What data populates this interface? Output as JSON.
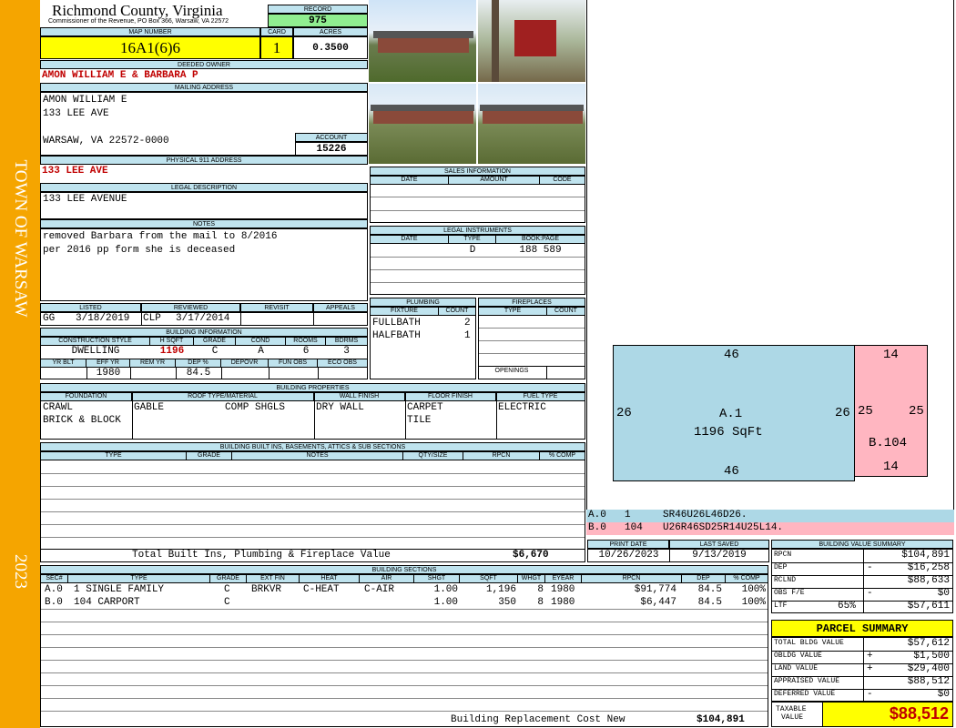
{
  "sidebar": {
    "town": "TOWN OF WARSAW",
    "year": "2023"
  },
  "header": {
    "county": "Richmond County, Virginia",
    "commissioner": "Commissioner of the Revenue, PO Box 366, Warsaw, VA 22572"
  },
  "record": {
    "label": "RECORD",
    "value": "975"
  },
  "map": {
    "label": "MAP NUMBER",
    "value": "16A1(6)6"
  },
  "card": {
    "label": "CARD",
    "value": "1"
  },
  "acres": {
    "label": "ACRES",
    "value": "0.3500"
  },
  "owner": {
    "label": "DEEDED OWNER",
    "value": "AMON WILLIAM E & BARBARA P"
  },
  "mailing": {
    "label": "MAILING ADDRESS",
    "line1": "AMON WILLIAM E",
    "line2": "133 LEE AVE",
    "line3": "WARSAW, VA 22572-0000"
  },
  "account": {
    "label": "ACCOUNT",
    "value": "15226"
  },
  "physical": {
    "label": "PHYSICAL 911 ADDRESS",
    "value": "133 LEE AVE"
  },
  "legal": {
    "label": "LEGAL DESCRIPTION",
    "value": "133 LEE AVENUE"
  },
  "notes": {
    "label": "NOTES",
    "line1": "removed Barbara from the mail to 8/2016",
    "line2": "per 2016 pp form she is deceased"
  },
  "status": {
    "listed_label": "LISTED",
    "reviewed_label": "REVIEWED",
    "revisit_label": "REVISIT",
    "appeals_label": "APPEALS",
    "listed_by": "GG",
    "listed_date": "3/18/2019",
    "reviewed_by": "CLP",
    "reviewed_date": "3/17/2014"
  },
  "building_info": {
    "label": "BUILDING INFORMATION",
    "headers1": [
      "CONSTRUCTION STYLE",
      "H SQFT",
      "GRADE",
      "COND",
      "ROOMS",
      "BDRMS"
    ],
    "style": "DWELLING",
    "hsqft": "1196",
    "grade": "C",
    "cond": "A",
    "rooms": "6",
    "bdrms": "3",
    "headers2": [
      "YR BLT",
      "EFF YR",
      "REM YR",
      "DEP %",
      "DEPOVR",
      "FUN OBS",
      "ECO OBS"
    ],
    "eff_yr": "1980",
    "dep": "84.5"
  },
  "sales": {
    "label": "SALES INFORMATION",
    "headers": [
      "DATE",
      "AMOUNT",
      "CODE"
    ]
  },
  "legal_instruments": {
    "label": "LEGAL INSTRUMENTS",
    "headers": [
      "DATE",
      "TYPE",
      "BOOK:PAGE"
    ],
    "type": "D",
    "bookpage": "188 589"
  },
  "plumbing": {
    "label": "PLUMBING",
    "headers": [
      "FIXTURE",
      "COUNT"
    ],
    "rows": [
      {
        "fixture": "FULLBATH",
        "count": "2"
      },
      {
        "fixture": "HALFBATH",
        "count": "1"
      }
    ]
  },
  "fireplaces": {
    "label": "FIREPLACES",
    "headers": [
      "TYPE",
      "COUNT"
    ],
    "openings": "OPENINGS"
  },
  "properties": {
    "label": "BUILDING PROPERTIES",
    "headers": [
      "FOUNDATION",
      "ROOF TYPE/MATERIAL",
      "WALL FINISH",
      "FLOOR FINISH",
      "FUEL TYPE"
    ],
    "foundation1": "CRAWL",
    "foundation2": "BRICK & BLOCK",
    "roof_type": "GABLE",
    "roof_material": "COMP SHGLS",
    "wall": "DRY WALL",
    "floor1": "CARPET",
    "floor2": "TILE",
    "fuel": "ELECTRIC"
  },
  "builtins": {
    "label": "BUILDING BUILT INS, BASEMENTS, ATTICS & SUB SECTIONS",
    "headers": [
      "TYPE",
      "GRADE",
      "NOTES",
      "QTY/SIZE",
      "RPCN",
      "% COMP"
    ],
    "total_label": "Total Built Ins, Plumbing & Fireplace Value",
    "total_value": "$6,670"
  },
  "sections": {
    "label": "BUILDING SECTIONS",
    "headers": [
      "SEC#",
      "TYPE",
      "GRADE",
      "EXT FIN",
      "HEAT",
      "AIR",
      "SHGT",
      "SQFT",
      "WHGT",
      "EYEAR",
      "RPCN",
      "DEP",
      "% COMP"
    ],
    "rows": [
      {
        "sec": "A.0",
        "type": "1 SINGLE FAMILY",
        "grade": "C",
        "ext": "BRKVR",
        "heat": "C-HEAT",
        "air": "C-AIR",
        "shgt": "1.00",
        "sqft": "1,196",
        "whgt": "8",
        "eyear": "1980",
        "rpcn": "$91,774",
        "dep": "84.5",
        "comp": "100%"
      },
      {
        "sec": "B.0",
        "type": "104 CARPORT",
        "grade": "C",
        "ext": "",
        "heat": "",
        "air": "",
        "shgt": "1.00",
        "sqft": "350",
        "whgt": "8",
        "eyear": "1980",
        "rpcn": "$6,447",
        "dep": "84.5",
        "comp": "100%"
      }
    ],
    "total_label": "Building Replacement Cost New",
    "total_value": "$104,891"
  },
  "sketch": {
    "a_top": "46",
    "a_bottom": "46",
    "a_left": "26",
    "a_right": "26",
    "a_name": "A.1",
    "a_area": "1196 SqFt",
    "b_top": "14",
    "b_bottom": "14",
    "b_left": "25",
    "b_right": "25",
    "b_name": "B.104",
    "colors": {
      "a": "#add8e6",
      "b": "#ffb6c1"
    }
  },
  "sketch_legend": {
    "a_code": "A.0",
    "a_num": "1",
    "a_vec": "SR46U26L46D26.",
    "b_code": "B.0",
    "b_num": "104",
    "b_vec": "U26R46SD25R14U25L14."
  },
  "dates": {
    "print_label": "PRINT DATE",
    "print_value": "10/26/2023",
    "saved_label": "LAST SAVED",
    "saved_value": "9/13/2019"
  },
  "value_summary": {
    "label": "BUILDING VALUE SUMMARY",
    "rpcn_label": "RPCN",
    "rpcn": "$104,891",
    "dep_label": "DEP",
    "dep_sign": "-",
    "dep": "$16,258",
    "rclnd_label": "RCLND",
    "rclnd": "$88,633",
    "obs_label": "OBS F/E",
    "obs_sign": "-",
    "obs": "$0",
    "ltf_label": "LTF",
    "ltf_pct": "65%",
    "ltf": "$57,611"
  },
  "parcel": {
    "label": "PARCEL SUMMARY",
    "total_bldg_label": "TOTAL BLDG VALUE",
    "total_bldg": "$57,612",
    "obldg_label": "OBLDG VALUE",
    "obldg_sign": "+",
    "obldg": "$1,500",
    "land_label": "LAND VALUE",
    "land_sign": "+",
    "land": "$29,400",
    "appraised_label": "APPRAISED VALUE",
    "appraised": "$88,512",
    "deferred_label": "DEFERRED VALUE",
    "deferred_sign": "-",
    "deferred": "$0",
    "taxable_label1": "TAXABLE",
    "taxable_label2": "VALUE",
    "taxable": "$88,512"
  },
  "colors": {
    "sidebar": "#f5a500",
    "header_blue": "#bfe3ee",
    "yellow": "#ffff00",
    "green": "#90ee90",
    "red_text": "#c00000"
  }
}
